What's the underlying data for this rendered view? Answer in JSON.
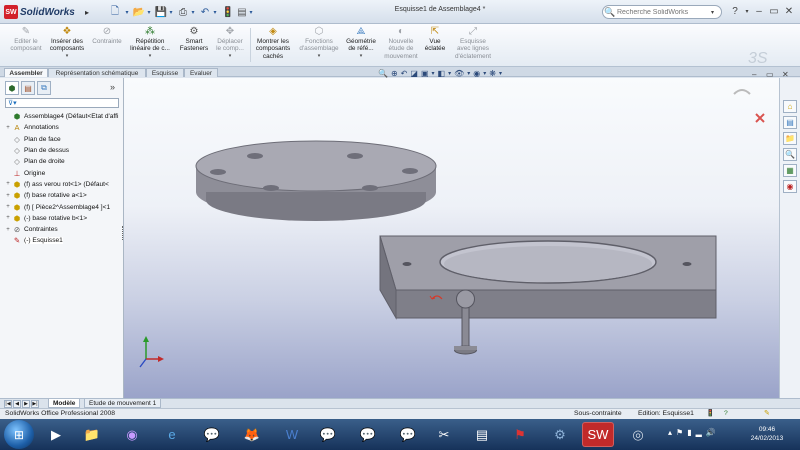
{
  "app": {
    "name": "SolidWorks",
    "badge": "SW",
    "doc_title": "Esquisse1 de Assemblage4 *",
    "search_placeholder": "Recherche SolidWorks"
  },
  "quick_access": [
    "new-file-icon",
    "open-folder-icon",
    "save-icon",
    "print-icon",
    "undo-icon",
    "rebuild-icon",
    "options-icon"
  ],
  "ribbon": [
    {
      "name": "editer-composant",
      "label": "Editer le\ncomposant",
      "icon": "✎",
      "dim": true
    },
    {
      "name": "inserer-composants",
      "label": "Insérer des\ncomposants",
      "icon": "❖",
      "dim": false,
      "drop": true
    },
    {
      "name": "contrainte",
      "label": "Contrainte",
      "icon": "⊘",
      "dim": true
    },
    {
      "name": "repetition",
      "label": "Répétition\nlinéaire de c...",
      "icon": "⁂",
      "dim": false,
      "drop": true
    },
    {
      "name": "smart-fasteners",
      "label": "Smart\nFasteners",
      "icon": "⚙",
      "dim": false
    },
    {
      "name": "deplacer",
      "label": "Déplacer\nle comp...",
      "icon": "✥",
      "dim": true,
      "drop": true
    },
    {
      "name": "montrer-composants",
      "label": "Montrer les\ncomposants\ncachés",
      "icon": "◈",
      "dim": false
    },
    {
      "name": "fonctions-assemblage",
      "label": "Fonctions\nd'assemblage",
      "icon": "⬡",
      "dim": true,
      "drop": true
    },
    {
      "name": "geometrie-reference",
      "label": "Géométrie\nde réfé...",
      "icon": "⟁",
      "dim": false,
      "drop": true
    },
    {
      "name": "nouvelle-etude",
      "label": "Nouvelle\nétude de\nmouvement",
      "icon": "◐",
      "dim": true
    },
    {
      "name": "vue-eclatee",
      "label": "Vue\néclatée",
      "icon": "⇱",
      "dim": false
    },
    {
      "name": "esquisse-lignes",
      "label": "Esquisse\navec lignes\nd'éclatement",
      "icon": "⤢",
      "dim": true
    }
  ],
  "tabs": [
    "Assembler",
    "Représentation schématique",
    "Esquisse",
    "Evaluer"
  ],
  "panel": {
    "filter_icon": "filter-icon",
    "tree": [
      {
        "label": "Assemblage4  (Défaut<Etat d'affi",
        "icon": "⬢",
        "color": "#2d7a2d",
        "exp": "",
        "indent": 0
      },
      {
        "label": "Annotations",
        "icon": "A",
        "color": "#b8860b",
        "exp": "+",
        "indent": 1
      },
      {
        "label": "Plan de face",
        "icon": "◇",
        "color": "#777",
        "exp": "",
        "indent": 1
      },
      {
        "label": "Plan de dessus",
        "icon": "◇",
        "color": "#777",
        "exp": "",
        "indent": 1
      },
      {
        "label": "Plan de droite",
        "icon": "◇",
        "color": "#777",
        "exp": "",
        "indent": 1
      },
      {
        "label": "Origine",
        "icon": "⊥",
        "color": "#b22",
        "exp": "",
        "indent": 1
      },
      {
        "label": "(f) ass verou rot<1> (Défaut<",
        "icon": "⬢",
        "color": "#c9a000",
        "exp": "+",
        "indent": 1
      },
      {
        "label": "(f) base rotative a<1>",
        "icon": "⬢",
        "color": "#c9a000",
        "exp": "+",
        "indent": 1
      },
      {
        "label": "(f) [ Pièce2^Assemblage4 ]<1",
        "icon": "⬢",
        "color": "#c9a000",
        "exp": "+",
        "indent": 1
      },
      {
        "label": "(-) base rotative b<1>",
        "icon": "⬢",
        "color": "#c9a000",
        "exp": "+",
        "indent": 1
      },
      {
        "label": "Contraintes",
        "icon": "⊘",
        "color": "#555",
        "exp": "+",
        "indent": 1
      },
      {
        "label": "(-) Esquisse1",
        "icon": "✎",
        "color": "#b22",
        "exp": "",
        "indent": 1
      }
    ]
  },
  "bottom_tabs": [
    "Modèle",
    "Etude de mouvement 1"
  ],
  "status": {
    "product": "SolidWorks Office Professional 2008",
    "state": "Sous-contrainte",
    "edition": "Edition: Esquisse1"
  },
  "clock": {
    "time": "09:46",
    "date": "24/02/2013"
  },
  "colors": {
    "accent": "#d2202a",
    "part": "#9b9ba4",
    "viewport_bottom": "#9aa3c9"
  }
}
